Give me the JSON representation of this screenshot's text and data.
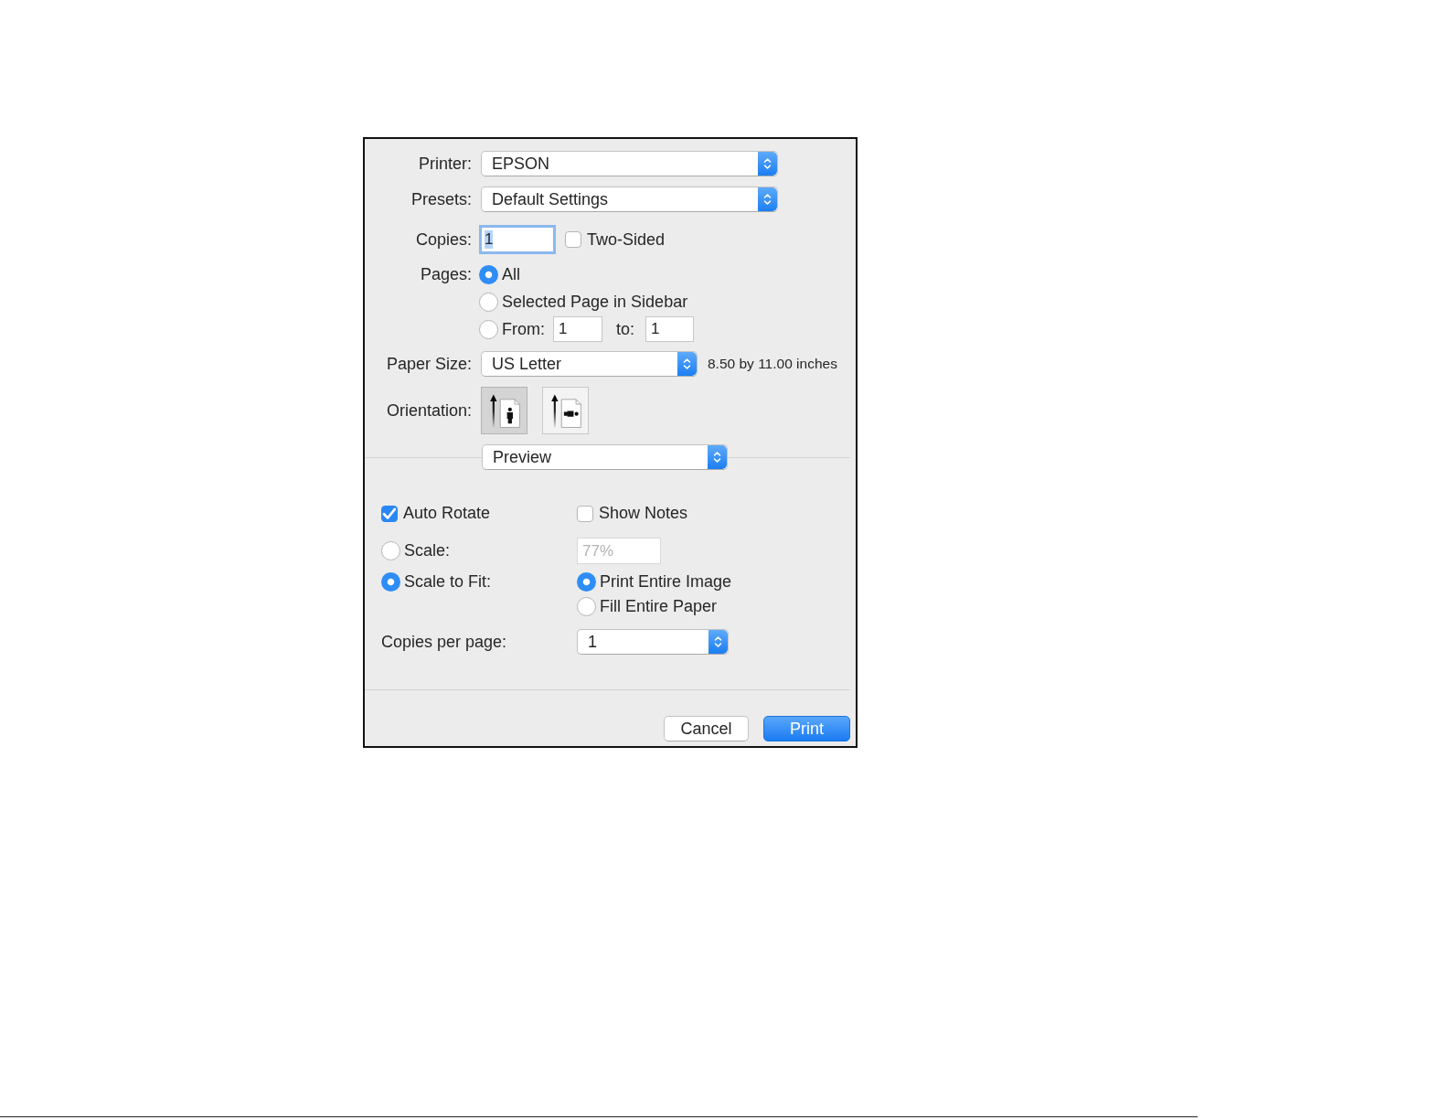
{
  "printer": {
    "label": "Printer:",
    "value": "EPSON"
  },
  "presets": {
    "label": "Presets:",
    "value": "Default Settings"
  },
  "copies": {
    "label": "Copies:",
    "value": "1",
    "focused": true
  },
  "two_sided": {
    "label": "Two-Sided",
    "checked": false
  },
  "pages": {
    "label": "Pages:",
    "options": [
      {
        "kind": "plain",
        "label": "All",
        "selected": true
      },
      {
        "kind": "plain",
        "label": "Selected Page in Sidebar",
        "selected": false
      },
      {
        "kind": "range",
        "label": "From:",
        "selected": false,
        "from": "1",
        "to_label": "to:",
        "to": "1"
      }
    ]
  },
  "paper_size": {
    "label": "Paper Size:",
    "value": "US Letter",
    "dimensions": "8.50 by 11.00 inches"
  },
  "orientation": {
    "label": "Orientation:",
    "options": [
      {
        "kind": "portrait",
        "selected": true
      },
      {
        "kind": "landscape",
        "selected": false
      }
    ]
  },
  "section_menu": {
    "value": "Preview"
  },
  "auto_rotate": {
    "label": "Auto Rotate",
    "checked": true
  },
  "show_notes": {
    "label": "Show Notes",
    "checked": false
  },
  "scale": {
    "label": "Scale:",
    "selected": false,
    "value": "77%",
    "disabled": true
  },
  "scale_to_fit": {
    "label": "Scale to Fit:",
    "selected": true,
    "options": [
      {
        "label": "Print Entire Image",
        "selected": true
      },
      {
        "label": "Fill Entire Paper",
        "selected": false
      }
    ]
  },
  "copies_per_page": {
    "label": "Copies per page:",
    "value": "1"
  },
  "buttons": [
    {
      "kind": "cancel",
      "label": "Cancel"
    },
    {
      "kind": "default",
      "label": "Print"
    }
  ]
}
